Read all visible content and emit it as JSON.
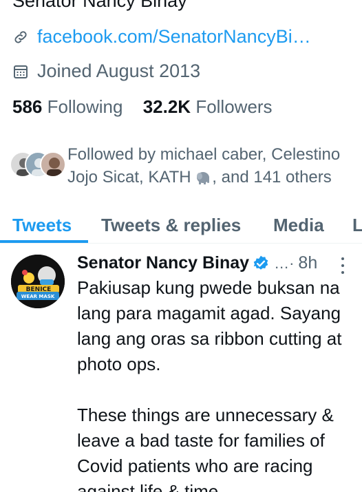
{
  "profile": {
    "name": "Senator Nancy Binay",
    "link": "facebook.com/SenatorNancyBi…",
    "joined": "Joined August 2013",
    "following_count": "586",
    "following_label": "Following",
    "followers_count": "32.2K",
    "followers_label": "Followers",
    "followed_by_prefix": "Followed by michael caber, Celestino Jojo Sicat, KATH",
    "followed_by_suffix": ", and 141 others"
  },
  "tabs": [
    {
      "label": "Tweets",
      "active": true
    },
    {
      "label": "Tweets & replies",
      "active": false
    },
    {
      "label": "Media",
      "active": false
    },
    {
      "label": "L",
      "active": false
    }
  ],
  "tweet": {
    "author": "Senator Nancy Binay",
    "dots": "…·",
    "time": "8h",
    "avatar_text_top": "BENICE",
    "avatar_text_bottom": "WEAR MASK",
    "paragraphs": [
      "Pakiusap kung pwede buksan na lang para magamit agad. Sayang lang ang oras sa ribbon cutting at photo ops.",
      "These things are unnecessary & leave a bad taste for families of Covid patients who are racing against life & time."
    ]
  },
  "colors": {
    "accent": "#1d9bf0",
    "text_primary": "#0f1419",
    "text_secondary": "#536471"
  },
  "icons": {
    "link": "link-icon",
    "calendar": "calendar-icon",
    "verified": "verified-badge-icon",
    "elephant": "elephant-emoji-icon",
    "more": "more-options-icon"
  }
}
